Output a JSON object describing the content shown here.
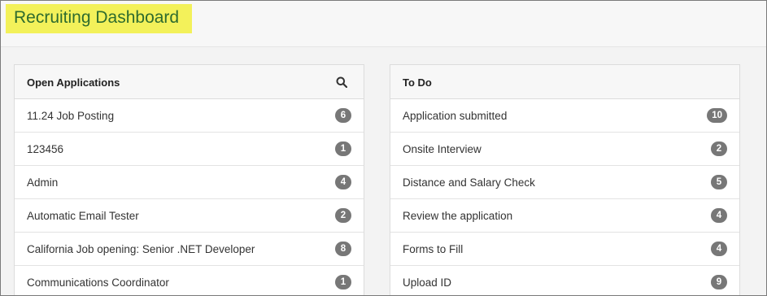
{
  "header": {
    "title": "Recruiting Dashboard"
  },
  "open_applications": {
    "title": "Open Applications",
    "items": [
      {
        "label": "11.24 Job Posting",
        "count": "6"
      },
      {
        "label": "123456",
        "count": "1"
      },
      {
        "label": "Admin",
        "count": "4"
      },
      {
        "label": "Automatic Email Tester",
        "count": "2"
      },
      {
        "label": "California Job opening: Senior .NET Developer",
        "count": "8"
      },
      {
        "label": "Communications Coordinator",
        "count": "1"
      }
    ]
  },
  "todo": {
    "title": "To Do",
    "items": [
      {
        "label": "Application submitted",
        "count": "10"
      },
      {
        "label": "Onsite Interview",
        "count": "2"
      },
      {
        "label": "Distance and Salary Check",
        "count": "5"
      },
      {
        "label": "Review the application",
        "count": "4"
      },
      {
        "label": "Forms to Fill",
        "count": "4"
      },
      {
        "label": "Upload ID",
        "count": "9"
      }
    ]
  },
  "colors": {
    "title_text": "#2e6b2e",
    "title_highlight": "#f3f15a",
    "badge_bg": "#777777"
  },
  "icons": {
    "open_applications_search": "search-icon"
  }
}
